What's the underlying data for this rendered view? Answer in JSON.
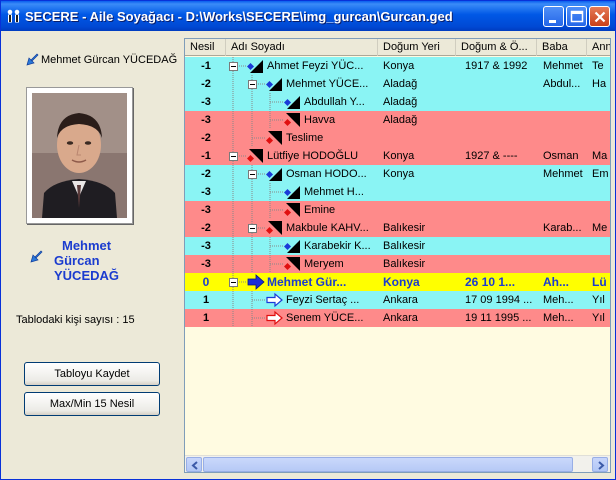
{
  "window": {
    "title": "SECERE - Aile Soyağacı - D:\\Works\\SECERE\\img_gurcan\\Gurcan.ged"
  },
  "left": {
    "selected_name": "Mehmet Gürcan YÜCEDAĞ",
    "big_name_lines": [
      "Mehmet",
      "Gürcan",
      "YÜCEDAĞ"
    ],
    "count_label": "Tablodaki kişi sayısı : 15",
    "save_button": "Tabloyu Kaydet",
    "maxmin_button": "Max/Min 15 Nesil"
  },
  "table": {
    "columns": [
      "Nesil",
      "Adı Soyadı",
      "Doğum Yeri",
      "Doğum & Ö...",
      "Baba",
      "Anne"
    ],
    "rows": [
      {
        "nesil": "-1",
        "name": "Ahmet Feyzi YÜC...",
        "dogumyeri": "Konya",
        "tarih": "1917 & 1992",
        "baba": "Mehmet",
        "anne": "Te",
        "color": "cyan",
        "sex": "male",
        "level": 0,
        "expander": "minus"
      },
      {
        "nesil": "-2",
        "name": "Mehmet YÜCE...",
        "dogumyeri": "Aladağ",
        "tarih": "",
        "baba": "Abdul...",
        "anne": "Ha",
        "color": "cyan",
        "sex": "male",
        "level": 1,
        "expander": "minus"
      },
      {
        "nesil": "-3",
        "name": "Abdullah Y...",
        "dogumyeri": "Aladağ",
        "tarih": "",
        "baba": "",
        "anne": "",
        "color": "cyan",
        "sex": "male",
        "level": 2,
        "expander": ""
      },
      {
        "nesil": "-3",
        "name": "Havva",
        "dogumyeri": "Aladağ",
        "tarih": "",
        "baba": "",
        "anne": "",
        "color": "pink",
        "sex": "female",
        "level": 2,
        "expander": ""
      },
      {
        "nesil": "-2",
        "name": "Teslime",
        "dogumyeri": "",
        "tarih": "",
        "baba": "",
        "anne": "",
        "color": "pink",
        "sex": "female",
        "level": 1,
        "expander": ""
      },
      {
        "nesil": "-1",
        "name": "Lütfiye HODOĞLU",
        "dogumyeri": "Konya",
        "tarih": "1927 & ----",
        "baba": "Osman",
        "anne": "Ma",
        "color": "pink",
        "sex": "female",
        "level": 0,
        "expander": "minus"
      },
      {
        "nesil": "-2",
        "name": "Osman HODO...",
        "dogumyeri": "Konya",
        "tarih": "",
        "baba": "Mehmet",
        "anne": "Em",
        "color": "cyan",
        "sex": "male",
        "level": 1,
        "expander": "minus"
      },
      {
        "nesil": "-3",
        "name": "Mehmet H...",
        "dogumyeri": "",
        "tarih": "",
        "baba": "",
        "anne": "",
        "color": "cyan",
        "sex": "male",
        "level": 2,
        "expander": ""
      },
      {
        "nesil": "-3",
        "name": "Emine",
        "dogumyeri": "",
        "tarih": "",
        "baba": "",
        "anne": "",
        "color": "pink",
        "sex": "female",
        "level": 2,
        "expander": ""
      },
      {
        "nesil": "-2",
        "name": "Makbule KAHV...",
        "dogumyeri": "Balıkesir",
        "tarih": "",
        "baba": "Karab...",
        "anne": "Me",
        "color": "pink",
        "sex": "female",
        "level": 1,
        "expander": "minus"
      },
      {
        "nesil": "-3",
        "name": "Karabekir K...",
        "dogumyeri": "Balıkesir",
        "tarih": "",
        "baba": "",
        "anne": "",
        "color": "cyan",
        "sex": "male",
        "level": 2,
        "expander": ""
      },
      {
        "nesil": "-3",
        "name": "Meryem",
        "dogumyeri": "Balıkesir",
        "tarih": "",
        "baba": "",
        "anne": "",
        "color": "pink",
        "sex": "female",
        "level": 2,
        "expander": ""
      },
      {
        "nesil": "0",
        "name": "Mehmet Gür...",
        "dogumyeri": "Konya",
        "tarih": "26 10 1...",
        "baba": "Ah...",
        "anne": "Lü",
        "color": "yellow",
        "sex": "self",
        "level": 0,
        "expander": "minus"
      },
      {
        "nesil": "1",
        "name": "Feyzi Sertaç ...",
        "dogumyeri": "Ankara",
        "tarih": "17 09 1994 ...",
        "baba": "Meh...",
        "anne": "Yıl",
        "color": "cyan",
        "sex": "son",
        "level": 1,
        "expander": ""
      },
      {
        "nesil": "1",
        "name": "Senem YÜCE...",
        "dogumyeri": "Ankara",
        "tarih": "19 11 1995 ...",
        "baba": "Meh...",
        "anne": "Yıl",
        "color": "pink",
        "sex": "daughter",
        "level": 1,
        "expander": ""
      }
    ]
  },
  "colors": {
    "cyan": "#8af4f4",
    "pink": "#fe8a8a",
    "yellow": "#ffff00",
    "self_text": "#1b3ccf"
  }
}
